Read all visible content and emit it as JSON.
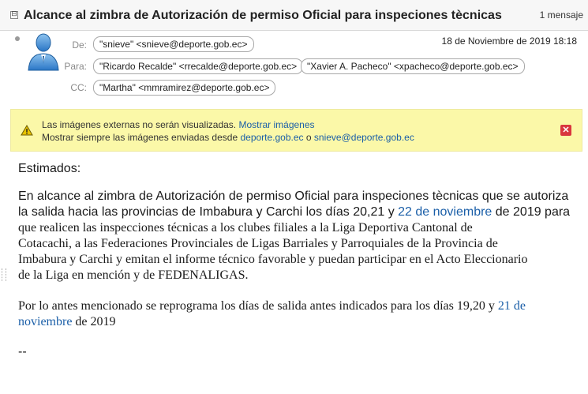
{
  "header": {
    "collapse_symbol": "⊟",
    "subject": "Alcance al zimbra de Autorización de permiso Oficial para inspeciones tècnicas",
    "message_count": "1 mensaje"
  },
  "message": {
    "from_label": "De:",
    "from": "\"snieve\" <snieve@deporte.gob.ec>",
    "to_label": "Para:",
    "to": [
      "\"Ricardo Recalde\" <rrecalde@deporte.gob.ec>",
      "\"Xavier A. Pacheco\" <xpacheco@deporte.gob.ec>"
    ],
    "cc_label": "CC:",
    "cc": [
      "\"Martha\" <mmramirez@deporte.gob.ec>"
    ],
    "date": "18 de Noviembre de 2019 18:18"
  },
  "notice": {
    "line1_text": "Las imágenes externas no serán visualizadas.",
    "show_images_link": "Mostrar imágenes",
    "line2_text": "Mostrar siempre las imágenes enviadas desde",
    "domain_link": "deporte.gob.ec",
    "or_text": "o",
    "sender_link": "snieve@deporte.gob.ec",
    "close_symbol": "✕",
    "colors": {
      "background": "#fbf8a8",
      "link": "#1b5fa8",
      "close": "#d9363e"
    }
  },
  "body": {
    "greeting": "Estimados:",
    "p1_l1": "En alcance al zimbra de Autorización de permiso Oficial para inspeciones tècnicas que se autoriza",
    "p1_l2a": "la salida hacia las provincias de Imbabura y Carchi los días 20,21 y ",
    "p1_l2_date": "22 de noviembre",
    "p1_l2b": " de 2019 para",
    "p1_l3": "que realicen las inspecciones técnicas a los clubes filiales a la Liga Deportiva Cantonal de",
    "p1_l4": "Cotacachi,  a las Federaciones Provinciales de Ligas Barriales y Parroquiales de la Provincia de",
    "p1_l5": "Imbabura y Carchi y emitan  el informe técnico favorable y puedan participar en el Acto Eleccionario",
    "p1_l6": "de la Liga en mención y de FEDENALIGAS.",
    "p2_l1a": "Por lo antes mencionado se reprograma los días de salida antes indicados para los días 19,20 y ",
    "p2_l1_date": "21 de",
    "p2_l2_date": "noviembre",
    "p2_l2b": " de 2019",
    "signature": "--"
  }
}
